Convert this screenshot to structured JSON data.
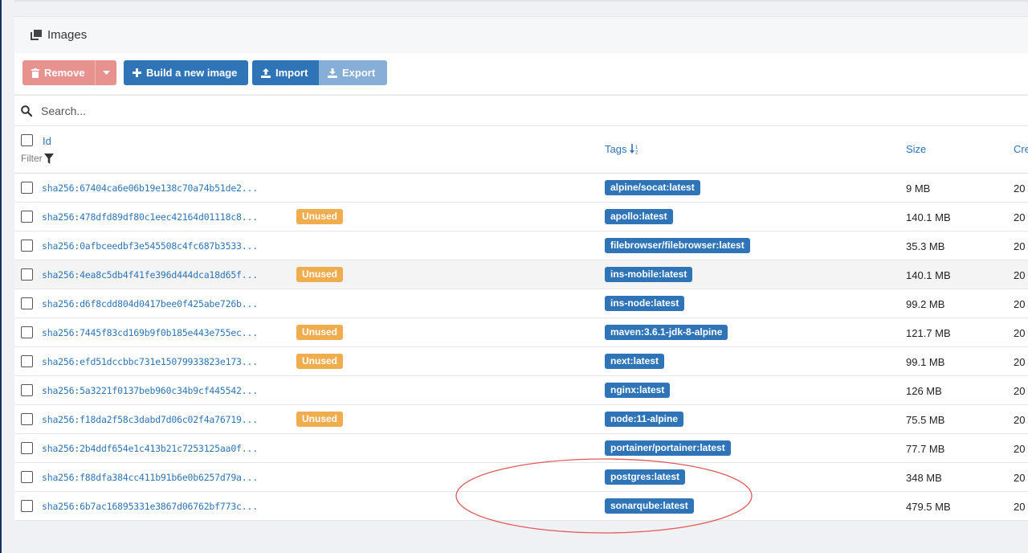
{
  "panel": {
    "title": "Images",
    "icon": "clone-icon"
  },
  "toolbar": {
    "remove_label": "Remove",
    "build_label": "Build a new image",
    "import_label": "Import",
    "export_label": "Export",
    "colors": {
      "danger": "#e8928f",
      "primary": "#2e74b7",
      "primary_disabled": "#86aed6",
      "warning": "#f0ad4e"
    }
  },
  "search": {
    "placeholder": "Search..."
  },
  "table": {
    "headers": {
      "id": "Id",
      "filter": "Filter",
      "tags": "Tags",
      "size": "Size",
      "created": "Cre"
    },
    "rows": [
      {
        "id": "sha256:67404ca6e06b19e138c70a74b51de2...",
        "unused": "",
        "tag": "alpine/socat:latest",
        "size": "9 MB",
        "created": "20"
      },
      {
        "id": "sha256:478dfd89df80c1eec42164d01118c8...",
        "unused": "Unused",
        "tag": "apollo:latest",
        "size": "140.1 MB",
        "created": "20"
      },
      {
        "id": "sha256:0afbceedbf3e545508c4fc687b3533...",
        "unused": "",
        "tag": "filebrowser/filebrowser:latest",
        "size": "35.3 MB",
        "created": "20"
      },
      {
        "id": "sha256:4ea8c5db4f41fe396d444dca18d65f...",
        "unused": "Unused",
        "tag": "ins-mobile:latest",
        "size": "140.1 MB",
        "created": "20"
      },
      {
        "id": "sha256:d6f8cdd804d0417bee0f425abe726b...",
        "unused": "",
        "tag": "ins-node:latest",
        "size": "99.2 MB",
        "created": "20"
      },
      {
        "id": "sha256:7445f83cd169b9f0b185e443e755ec...",
        "unused": "Unused",
        "tag": "maven:3.6.1-jdk-8-alpine",
        "size": "121.7 MB",
        "created": "20"
      },
      {
        "id": "sha256:efd51dccbbc731e15079933823e173...",
        "unused": "Unused",
        "tag": "next:latest",
        "size": "99.1 MB",
        "created": "20"
      },
      {
        "id": "sha256:5a3221f0137beb960c34b9cf445542...",
        "unused": "",
        "tag": "nginx:latest",
        "size": "126 MB",
        "created": "20"
      },
      {
        "id": "sha256:f18da2f58c3dabd7d06c02f4a76719...",
        "unused": "Unused",
        "tag": "node:11-alpine",
        "size": "75.5 MB",
        "created": "20"
      },
      {
        "id": "sha256:2b4ddf654e1c413b21c7253125aa0f...",
        "unused": "",
        "tag": "portainer/portainer:latest",
        "size": "77.7 MB",
        "created": "20"
      },
      {
        "id": "sha256:f88dfa384cc411b91b6e0b6257d79a...",
        "unused": "",
        "tag": "postgres:latest",
        "size": "348 MB",
        "created": "20"
      },
      {
        "id": "sha256:6b7ac16895331e3867d06762bf773c...",
        "unused": "",
        "tag": "sonarqube:latest",
        "size": "479.5 MB",
        "created": "20"
      }
    ]
  }
}
